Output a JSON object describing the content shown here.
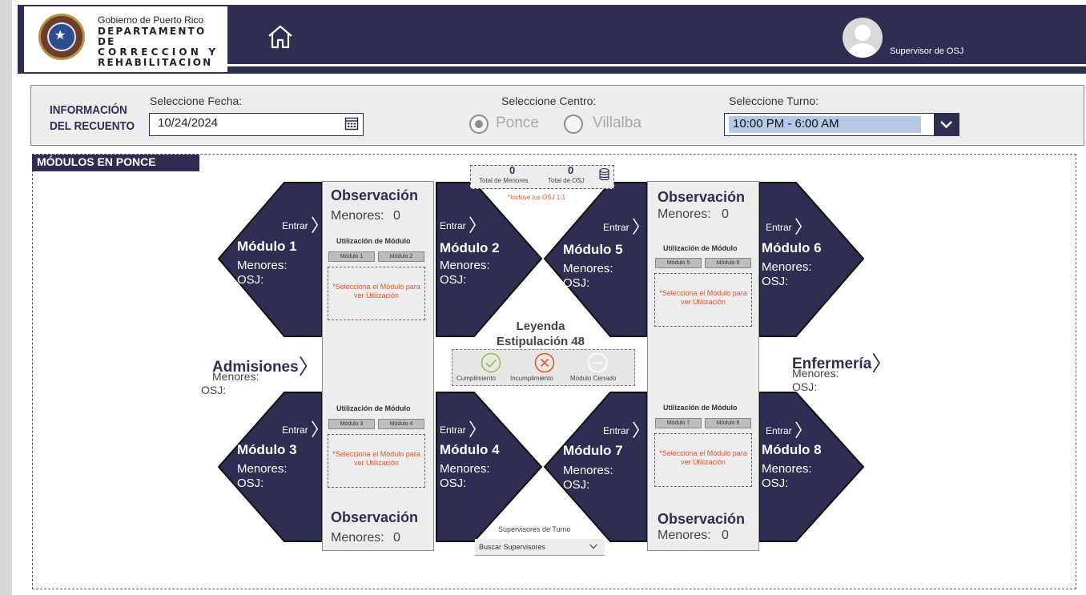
{
  "header": {
    "org_line1": "Gobierno de Puerto Rico",
    "org_line2": "DEPARTAMENTO DE",
    "org_line3": "CORRECCION Y",
    "org_line4": "REHABILITACION",
    "user_label": "Supervisor de OSJ",
    "home_icon": "home-icon",
    "avatar_icon": "user-avatar-icon"
  },
  "info": {
    "title_line1": "INFORMACIÓN",
    "title_line2": "DEL RECUENTO",
    "fecha_label": "Seleccione Fecha:",
    "fecha_value": "10/24/2024",
    "centro_label": "Seleccione Centro:",
    "centro_options": [
      "Ponce",
      "Villalba"
    ],
    "centro_selected": "Ponce",
    "turno_label": "Seleccione Turno:",
    "turno_value": "10:00 PM - 6:00 AM"
  },
  "main": {
    "section_title": "MÓDULOS EN PONCE",
    "totals": {
      "menores_value": "0",
      "menores_label": "Total de Menores",
      "osj_value": "0",
      "osj_label": "Total de OSJ",
      "note": "*Incluye los OSJ 1:1"
    },
    "observacion_label": "Observación",
    "menores_label": "Menores:",
    "osj_label": "OSJ:",
    "entrar_label": "Entrar",
    "observacion_value": "0",
    "utilizacion_label": "Utilización de Módulo",
    "selecciona_msg": "*Selecciona el Módulo para ver Utilización",
    "modules": [
      "Módulo 1",
      "Módulo 2",
      "Módulo 3",
      "Módulo 4",
      "Módulo 5",
      "Módulo 6",
      "Módulo 7",
      "Módulo 8"
    ],
    "admisiones": "Admisiones",
    "enfermeria": "Enfermería",
    "legend": {
      "title1": "Leyenda",
      "title2": "Estipulación 48",
      "items": [
        "Cumplimiento",
        "Incumplimiento",
        "Módulo Cerrado"
      ],
      "colors": {
        "cumplimiento": "#8bc34a",
        "incumplimiento": "#e0552c",
        "cerrado": "#ffffff"
      }
    },
    "supervisores_label": "Supervisores de Turno",
    "supervisores_placeholder": "Buscar Supervisores"
  },
  "colors": {
    "primary": "#2d2e52",
    "panel": "#ededed"
  }
}
